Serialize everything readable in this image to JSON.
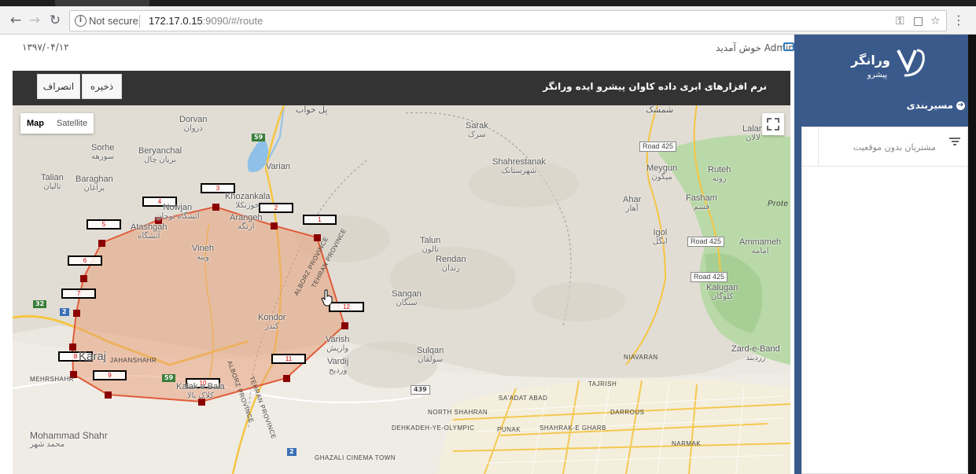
{
  "browser": {
    "security_label": "Not secure",
    "url_host": "172.17.0.15",
    "url_rest": ":9090/#/route",
    "menu_icon": "more-vert-icon"
  },
  "app": {
    "date": "۱۳۹۷/۰۴/۱۲",
    "welcome": "Admin خوش آمدید",
    "title": "نرم افزارهای ابری داده کاوان پیشرو ایده ورانگر",
    "save_label": "ذخیره",
    "cancel_label": "انصراف"
  },
  "map": {
    "type_map": "Map",
    "type_satellite": "Satellite",
    "places": [
      {
        "en": "Dorvan",
        "fa": "دروان"
      },
      {
        "en": "Sorhe",
        "fa": "سورهه"
      },
      {
        "en": "Beryanchal",
        "fa": "بریان چال"
      },
      {
        "en": "Talian",
        "fa": "تالیان"
      },
      {
        "en": "Baraghan",
        "fa": "براغان"
      },
      {
        "en": "Nowjan",
        "fa": "آتشگاه نوجان"
      },
      {
        "en": "Atashgah",
        "fa": "آتشگاه"
      },
      {
        "en": "Khozankala",
        "fa": "خوزنکلا"
      },
      {
        "en": "Arangeh",
        "fa": "ارنگه"
      },
      {
        "en": "Vineh",
        "fa": "وینه"
      },
      {
        "en": "Varian",
        "fa": ""
      },
      {
        "en": "Sarak",
        "fa": "سرک"
      },
      {
        "en": "Shahrestanak",
        "fa": "شهرستانک"
      },
      {
        "en": "Shemshak",
        "fa": "شمشک"
      },
      {
        "en": "Lalan",
        "fa": "لالان"
      },
      {
        "en": "Meygun",
        "fa": "میگون"
      },
      {
        "en": "Ruteh",
        "fa": "روته"
      },
      {
        "en": "Ahar",
        "fa": "آهار"
      },
      {
        "en": "Fasham",
        "fa": "فشم"
      },
      {
        "en": "Igol",
        "fa": "ایگل"
      },
      {
        "en": "Ammameh",
        "fa": "امامه"
      },
      {
        "en": "Talun",
        "fa": "تالون"
      },
      {
        "en": "Rendan",
        "fa": "رندان"
      },
      {
        "en": "Sangan",
        "fa": "سنگان"
      },
      {
        "en": "Kalugan",
        "fa": "کلوگان"
      },
      {
        "en": "Kondor",
        "fa": "کندر"
      },
      {
        "en": "Varish",
        "fa": "واریش"
      },
      {
        "en": "Vardij",
        "fa": "وردیج"
      },
      {
        "en": "Sulqan",
        "fa": "سولقان"
      },
      {
        "en": "Zard-e-Band",
        "fa": "زردبند"
      },
      {
        "en": "Karaj",
        "fa": "کرج"
      },
      {
        "en": "Kalak e Bala",
        "fa": "کلاک بالا"
      },
      {
        "en": "Mohammad Shahr",
        "fa": "محمد شهر"
      }
    ],
    "districts": [
      "ALBORZ PROVINCE",
      "TEHRAN PROVINCE",
      "ALBORZ PROVINCE",
      "TEHRAN PROVINCE",
      "MEHRSHAHR",
      "JAHANSHAHR",
      "NIAVARAN",
      "TAJRISH",
      "SA'ADAT ABAD",
      "DARROUS",
      "NORTH SHAHRAN",
      "DEHKADEH-YE-OLYMPIC",
      "PUNAK",
      "SHAHRAK-E GHARB",
      "NARMAK",
      "GHAZALI CINEMA TOWN",
      "Prote"
    ],
    "roads": [
      "Road 425",
      "Road 425",
      "Road 425"
    ],
    "route_shields": [
      "59",
      "32",
      "2",
      "59",
      "439",
      "2"
    ],
    "polygon_labels": [
      "1",
      "2",
      "3",
      "4",
      "5",
      "6",
      "7",
      "8",
      "9",
      "10",
      "11",
      "12"
    ],
    "polygon_color": "#e8a07a",
    "vertex_color": "#8b0000",
    "top_place": "پل خواب"
  },
  "sidebar": {
    "logo_name": "ورانگر",
    "logo_sub": "پیشرو",
    "nav_label": "مسیربندی",
    "panel_title": "مشتریان بدون موقعیت"
  }
}
